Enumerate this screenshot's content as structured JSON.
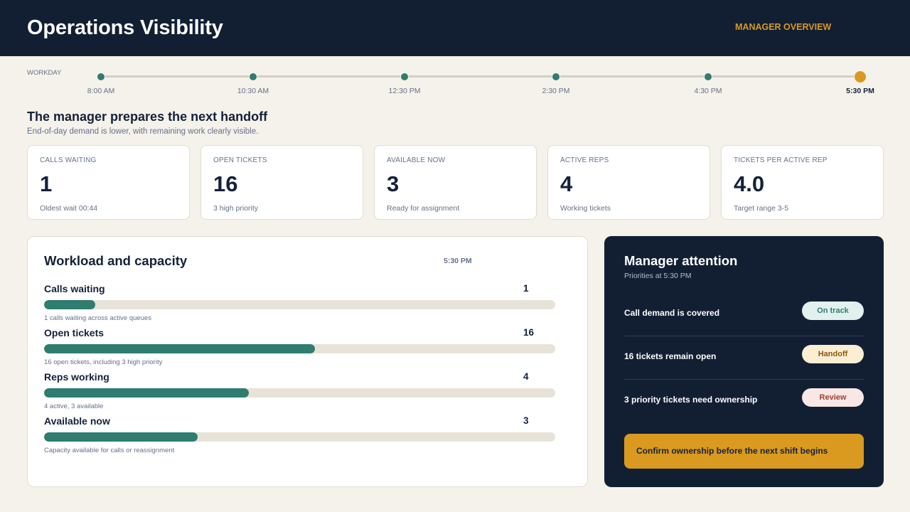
{
  "header": {
    "title": "Operations Visibility",
    "link_label": "MANAGER OVERVIEW"
  },
  "timeline": {
    "label": "WORKDAY",
    "stops": [
      "8:00 AM",
      "10:30 AM",
      "12:30 PM",
      "2:30 PM",
      "4:30 PM",
      "5:30 PM"
    ],
    "active_stop": "5:30 PM"
  },
  "section": {
    "title": "The manager prepares the next handoff",
    "subtitle": "End-of-day demand is lower, with remaining work clearly visible."
  },
  "kpis": [
    {
      "label": "CALLS WAITING",
      "value": "1",
      "note": "Oldest wait 00:44"
    },
    {
      "label": "OPEN TICKETS",
      "value": "16",
      "note": "3 high priority"
    },
    {
      "label": "AVAILABLE NOW",
      "value": "3",
      "note": "Ready for assignment"
    },
    {
      "label": "ACTIVE REPS",
      "value": "4",
      "note": "Working tickets"
    },
    {
      "label": "TICKETS PER ACTIVE REP",
      "value": "4.0",
      "note": "Target range 3-5"
    }
  ],
  "workload": {
    "title": "Workload and capacity",
    "time": "5:30 PM",
    "metrics": [
      {
        "name": "Calls waiting",
        "value": "1",
        "fill_fraction": 0.1,
        "note": "1 calls waiting across active queues"
      },
      {
        "name": "Open tickets",
        "value": "16",
        "fill_fraction": 0.53,
        "note": "16 open tickets, including 3 high priority"
      },
      {
        "name": "Reps working",
        "value": "4",
        "fill_fraction": 0.4,
        "note": "4 active, 3 available"
      },
      {
        "name": "Available now",
        "value": "3",
        "fill_fraction": 0.3,
        "note": "Capacity available for calls or reassignment"
      }
    ]
  },
  "attention": {
    "title": "Manager attention",
    "subtitle": "Priorities at 5:30 PM",
    "items": [
      {
        "text": "Call demand is covered",
        "badge": "On track",
        "badge_bg": "#e3f1ee",
        "badge_color": "#2e7d6f"
      },
      {
        "text": "16 tickets remain open",
        "badge": "Handoff",
        "badge_bg": "#fbeed3",
        "badge_color": "#8a5a10"
      },
      {
        "text": "3 priority tickets need ownership",
        "badge": "Review",
        "badge_bg": "#f8e7e4",
        "badge_color": "#a3402f"
      }
    ],
    "action_label": "Confirm ownership before the next shift begins"
  },
  "colors": {
    "navy": "#121f33",
    "teal": "#2e7d6f",
    "amber": "#d99a1f",
    "background": "#f5f2eb"
  }
}
